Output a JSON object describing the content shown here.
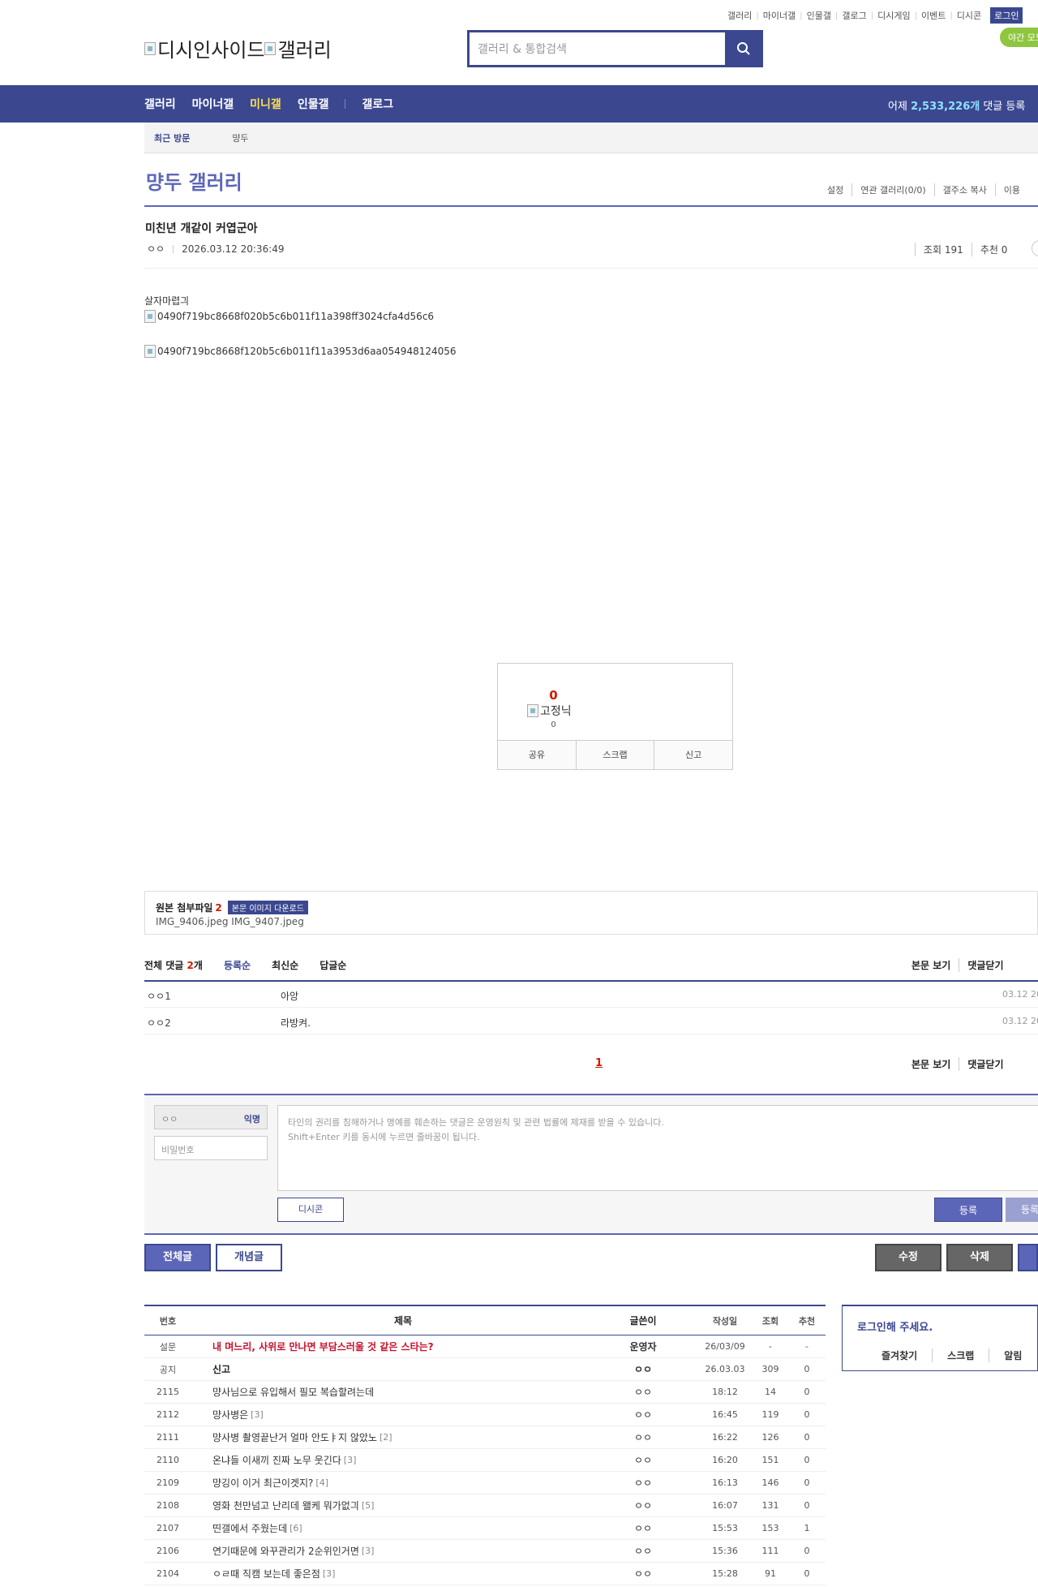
{
  "topmenu": {
    "items": [
      "갤러리",
      "마이너갤",
      "인물갤",
      "갤로그",
      "디시게임",
      "이벤트",
      "디시콘"
    ],
    "login": "로그인",
    "night_mode": "야간 모드"
  },
  "logo": {
    "text1": "디시인사이드",
    "text2": "갤러리"
  },
  "search": {
    "placeholder": "갤러리 & 통합검색"
  },
  "nav": {
    "items": [
      "갤러리",
      "마이너갤",
      "미니갤",
      "인물갤",
      "갤로그"
    ],
    "active_index": 2,
    "stats_prefix": "어제 ",
    "stats_value": "2,533,226개",
    "stats_suffix": " 댓글 등록"
  },
  "subnav": {
    "recent": "최근 방문",
    "gallery": "먕두"
  },
  "gallery": {
    "title": "먕두 갤러리",
    "tools": [
      "설정",
      "연관 갤러리(0/0)",
      "갤주소 복사",
      "이용"
    ]
  },
  "post": {
    "title": "미친년 개같이 커엽군아",
    "author": "ㅇㅇ",
    "datetime": "2026.03.12 20:36:49",
    "views": "조회 191",
    "recommends": "추천 0",
    "body_text": "살자마렵긔",
    "image1": "0490f719bc8668f020b5c6b011f11a398ff3024cfa4d56c6",
    "image2": "0490f719bc8668f120b5c6b011f11a3953d6aa054948124056",
    "rec_count": "0",
    "fixed_label": "고정닉",
    "fixed_count": "0",
    "actions": [
      "공유",
      "스크랩",
      "신고"
    ]
  },
  "attach": {
    "label": "원본 첨부파일",
    "count": "2",
    "download": "본문 이미지 다운로드",
    "files": "IMG_9406.jpeg  IMG_9407.jpeg"
  },
  "comments": {
    "total_label": "전체 댓글 ",
    "total_count": "2",
    "total_unit": "개",
    "sorts": [
      "등록순",
      "최신순",
      "답글순"
    ],
    "right": [
      "본문 보기",
      "댓글닫기"
    ],
    "items": [
      {
        "nick": "ㅇㅇ1",
        "text": "아앙",
        "date": "03.12 20"
      },
      {
        "nick": "ㅇㅇ2",
        "text": "라방켜.",
        "date": "03.12 20"
      }
    ],
    "page": "1"
  },
  "write": {
    "nick": "ㅇㅇ",
    "anon": "익명",
    "pw_placeholder": "비밀번호",
    "text_line1": "타인의 권리를 침해하거나 명예를 훼손하는 댓글은 운영원칙 및 관련 법률에 제재를 받을 수 있습니다.",
    "text_line2": "Shift+Enter 키를 동시에 누르면 줄바꿈이 됩니다.",
    "dccon": "디시콘",
    "submit": "등록",
    "submit2": "등록"
  },
  "buttons": {
    "all": "전체글",
    "concept": "개념글",
    "edit": "수정",
    "delete": "삭제"
  },
  "list": {
    "headers": [
      "번호",
      "제목",
      "글쓴이",
      "작성일",
      "조회",
      "추천"
    ],
    "rows": [
      {
        "no": "설문",
        "subject": "내 며느리, 사위로 만나면 부담스러울 것 같은 스타는?",
        "reply": "",
        "writer": "운영자",
        "date": "26/03/09",
        "views": "-",
        "rec": "-",
        "kind": "red"
      },
      {
        "no": "공지",
        "subject": "신고",
        "reply": "",
        "writer": "ㅇㅇ",
        "date": "26.03.03",
        "views": "309",
        "rec": "0",
        "kind": "notice"
      },
      {
        "no": "2115",
        "subject": "먕사님으로 유입해서 필모 복습할려는데",
        "reply": "",
        "writer": "ㅇㅇ",
        "date": "18:12",
        "views": "14",
        "rec": "0",
        "kind": ""
      },
      {
        "no": "2112",
        "subject": "먕사병은",
        "reply": "[3]",
        "writer": "ㅇㅇ",
        "date": "16:45",
        "views": "119",
        "rec": "0",
        "kind": ""
      },
      {
        "no": "2111",
        "subject": "먕사병 촬영끝난거 얼마 안도ㅑ지 않았노",
        "reply": "[2]",
        "writer": "ㅇㅇ",
        "date": "16:22",
        "views": "126",
        "rec": "0",
        "kind": ""
      },
      {
        "no": "2110",
        "subject": "온냐들 이새끼 진짜 노무 웃긴다",
        "reply": "[3]",
        "writer": "ㅇㅇ",
        "date": "16:20",
        "views": "151",
        "rec": "0",
        "kind": ""
      },
      {
        "no": "2109",
        "subject": "먕깅이 이거 최근이겟지?",
        "reply": "[4]",
        "writer": "ㅇㅇ",
        "date": "16:13",
        "views": "146",
        "rec": "0",
        "kind": ""
      },
      {
        "no": "2108",
        "subject": "영화 천만넘고 난리데 왤케 뭐가없긔",
        "reply": "[5]",
        "writer": "ㅇㅇ",
        "date": "16:07",
        "views": "131",
        "rec": "0",
        "kind": ""
      },
      {
        "no": "2107",
        "subject": "띤갤에서 주웠는데",
        "reply": "[6]",
        "writer": "ㅇㅇ",
        "date": "15:53",
        "views": "153",
        "rec": "1",
        "kind": ""
      },
      {
        "no": "2106",
        "subject": "연기때문에 와꾸관리가 2순위인거면",
        "reply": "[3]",
        "writer": "ㅇㅇ",
        "date": "15:36",
        "views": "111",
        "rec": "0",
        "kind": ""
      },
      {
        "no": "2104",
        "subject": "ㅇㄹ때 직캠 보는데 좋은점",
        "reply": "[3]",
        "writer": "ㅇㅇ",
        "date": "15:28",
        "views": "91",
        "rec": "0",
        "kind": ""
      }
    ]
  },
  "side": {
    "login_title": "로그인해 주세요.",
    "links": [
      "즐겨찾기",
      "스크랩",
      "알림"
    ]
  },
  "colors": {
    "brand": "#3b4890",
    "accent": "#5c66b8",
    "red": "#d31900",
    "nav_active": "#ffe14a"
  }
}
